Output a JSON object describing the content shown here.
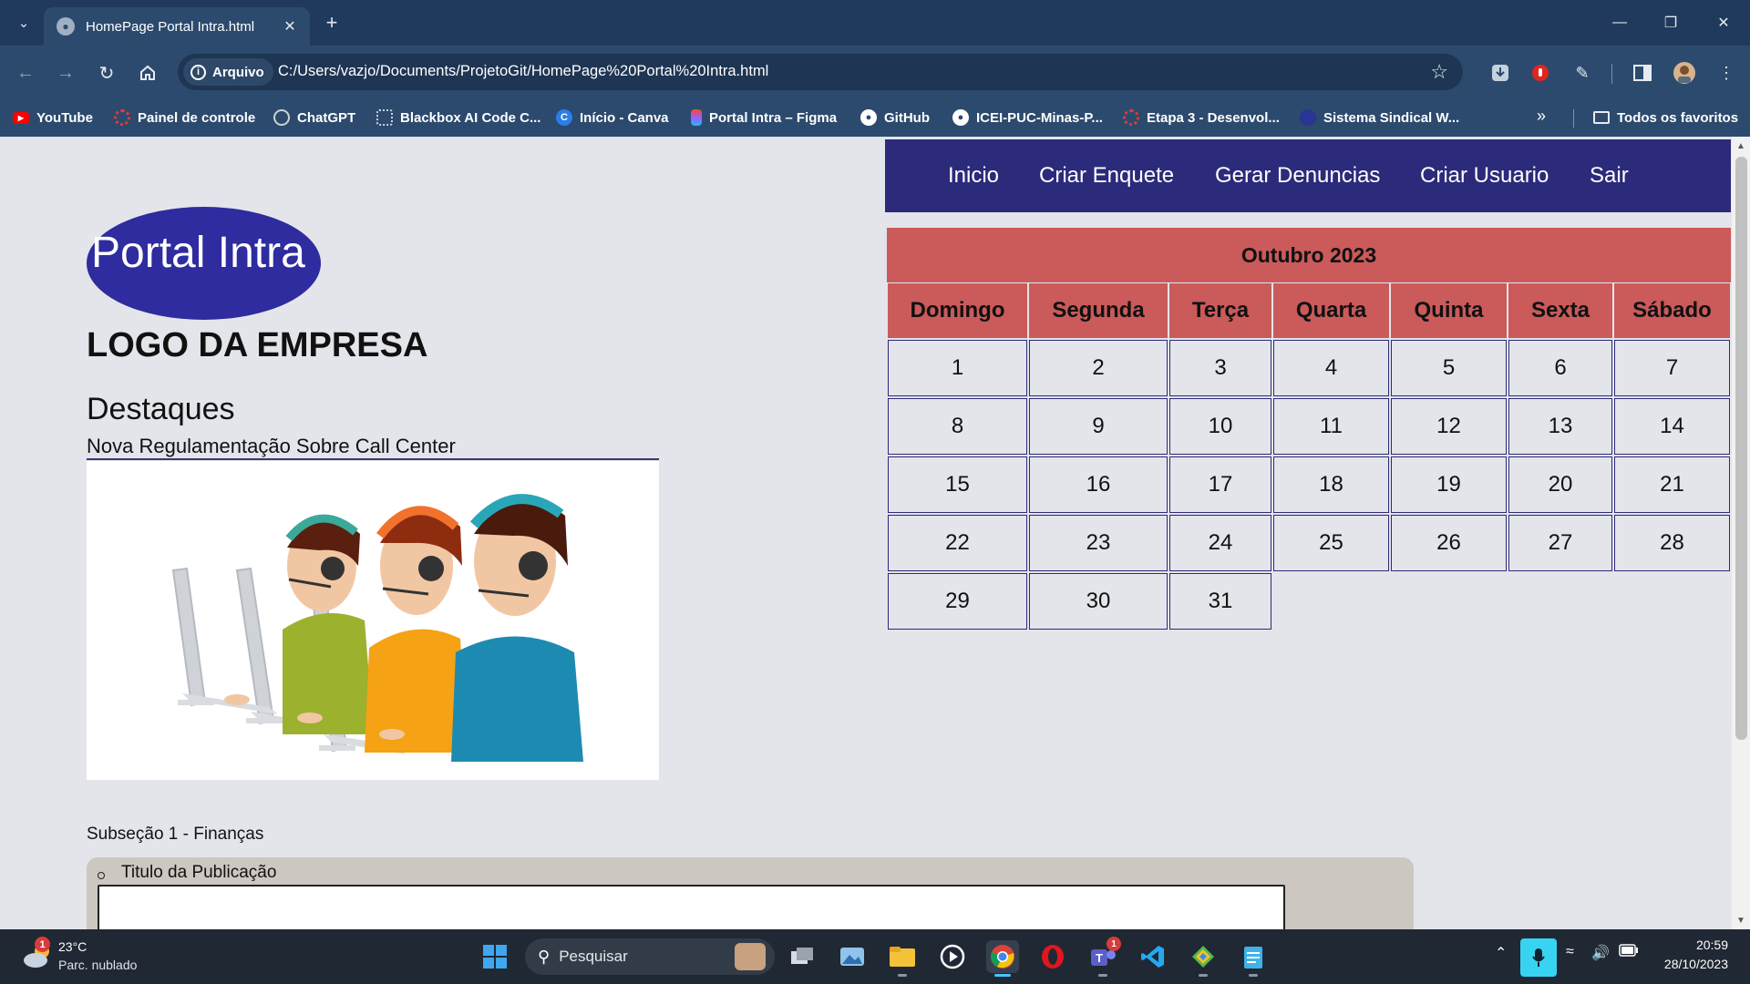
{
  "browser": {
    "tab_title": "HomePage Portal Intra.html",
    "site_chip_label": "Arquivo",
    "url": "C:/Users/vazjo/Documents/ProjetoGit/HomePage%20Portal%20Intra.html",
    "bookmarks": [
      {
        "label": "YouTube",
        "icon": "youtube-icon",
        "color": "#ff0000"
      },
      {
        "label": "Painel de controle",
        "icon": "gear-icon",
        "color": "#e53935"
      },
      {
        "label": "ChatGPT",
        "icon": "chatgpt-icon",
        "color": "#74aa9c"
      },
      {
        "label": "Blackbox AI Code C...",
        "icon": "blackbox-icon",
        "color": "#8e9aaf"
      },
      {
        "label": "Início - Canva",
        "icon": "canva-icon",
        "color": "#00c4cc"
      },
      {
        "label": "Portal Intra – Figma",
        "icon": "figma-icon",
        "color": "#f24e1e"
      },
      {
        "label": "GitHub",
        "icon": "github-icon",
        "color": "#ffffff"
      },
      {
        "label": "ICEI-PUC-Minas-P...",
        "icon": "github-icon",
        "color": "#ffffff"
      },
      {
        "label": "Etapa 3 - Desenvol...",
        "icon": "gear-icon",
        "color": "#e53935"
      },
      {
        "label": "Sistema Sindical W...",
        "icon": "globe-icon",
        "color": "#3949ab"
      }
    ],
    "all_bookmarks_label": "Todos os favoritos"
  },
  "page": {
    "logo_text": "Portal Intra",
    "company_label": "LOGO DA EMPRESA",
    "highlights_title": "Destaques",
    "news_link": "Nova Regulamentação Sobre Call Center",
    "subsection": "Subseção 1 - Finanças",
    "publication_title": "Titulo da Publicação",
    "nav": [
      "Inicio",
      "Criar Enquete",
      "Gerar Denuncias",
      "Criar Usuario",
      "Sair"
    ],
    "calendar": {
      "month": "Outubro 2023",
      "weekdays": [
        "Domingo",
        "Segunda",
        "Terça",
        "Quarta",
        "Quinta",
        "Sexta",
        "Sábado"
      ],
      "weeks": [
        [
          "1",
          "2",
          "3",
          "4",
          "5",
          "6",
          "7"
        ],
        [
          "8",
          "9",
          "10",
          "11",
          "12",
          "13",
          "14"
        ],
        [
          "15",
          "16",
          "17",
          "18",
          "19",
          "20",
          "21"
        ],
        [
          "22",
          "23",
          "24",
          "25",
          "26",
          "27",
          "28"
        ],
        [
          "29",
          "30",
          "31",
          "",
          "",
          "",
          ""
        ]
      ]
    }
  },
  "taskbar": {
    "weather_temp": "23°C",
    "weather_desc": "Parc. nublado",
    "weather_badge": "1",
    "search_placeholder": "Pesquisar",
    "time": "20:59",
    "date": "28/10/2023",
    "teams_badge": "1"
  },
  "colors": {
    "navbar": "#2c2a7a",
    "calendar_header": "#cb5a5a",
    "logo": "#2e2c9e",
    "chrome": "#2c4a6e"
  }
}
